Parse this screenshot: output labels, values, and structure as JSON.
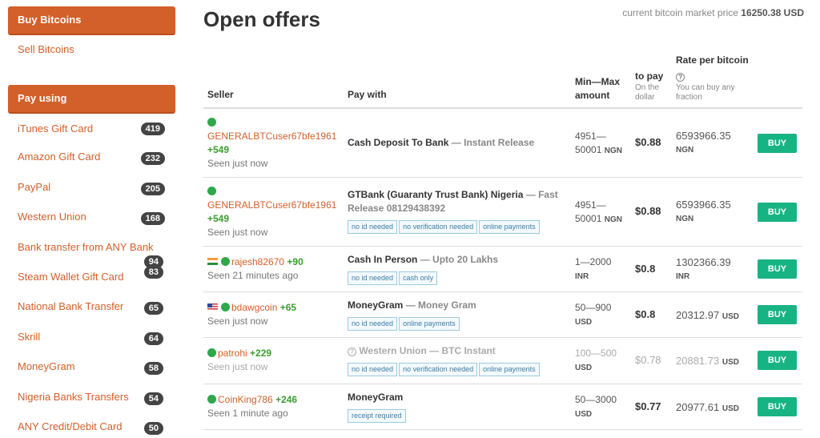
{
  "sidebar": {
    "buy_label": "Buy Bitcoins",
    "sell_label": "Sell Bitcoins",
    "pay_using_label": "Pay using",
    "items": [
      {
        "label": "iTunes Gift Card",
        "count": "419"
      },
      {
        "label": "Amazon Gift Card",
        "count": "232"
      },
      {
        "label": "PayPal",
        "count": "205"
      },
      {
        "label": "Western Union",
        "count": "168"
      },
      {
        "label": "Bank transfer from ANY Bank",
        "count": "94"
      },
      {
        "label": "Steam Wallet Gift Card",
        "count": "83"
      },
      {
        "label": "National Bank Transfer",
        "count": "65"
      },
      {
        "label": "Skrill",
        "count": "64"
      },
      {
        "label": "MoneyGram",
        "count": "58"
      },
      {
        "label": "Nigeria Banks Transfers",
        "count": "54"
      },
      {
        "label": "ANY Credit/Debit Card",
        "count": "50"
      }
    ]
  },
  "header": {
    "title": "Open offers",
    "market_prefix": "current bitcoin market price",
    "market_value": "16250.38 USD"
  },
  "columns": {
    "seller": "Seller",
    "pay_with": "Pay with",
    "min_max_1": "Min—Max",
    "min_max_2": "amount",
    "to_pay": "to pay",
    "to_pay_sub_1": "On the",
    "to_pay_sub_2": "dollar",
    "rate": "Rate per bitcoin",
    "rate_sub_1": "You can buy any",
    "rate_sub_2": "fraction"
  },
  "buy_label": "BUY",
  "offers": [
    {
      "seller": "GENERALBTCuser67bfe1961",
      "score": "+549",
      "seen": "Seen just now",
      "method": "Cash Deposit To Bank",
      "sep": " — ",
      "detail": "Instant Release",
      "tags": [],
      "amount_min": "4951—",
      "amount_max": "50001",
      "currency": "NGN",
      "to_pay": "$0.88",
      "rate": "6593966.35",
      "rate_currency": "NGN"
    },
    {
      "seller": "GENERALBTCuser67bfe1961",
      "score": "+549",
      "seen": "Seen just now",
      "method": "GTBank (Guaranty Trust Bank) Nigeria",
      "sep": " — ",
      "detail": "Fast Release 08129438392",
      "tags": [
        "no id needed",
        "no verification needed",
        "online payments"
      ],
      "amount_min": "4951—",
      "amount_max": "50001",
      "currency": "NGN",
      "to_pay": "$0.88",
      "rate": "6593966.35",
      "rate_currency": "NGN"
    },
    {
      "seller": "rajesh82670",
      "score": "+90",
      "seen": "Seen 21 minutes ago",
      "method": "Cash In Person",
      "sep": " — ",
      "detail": "Upto 20 Lakhs",
      "tags": [
        "no id needed",
        "cash only"
      ],
      "amount_min": "1—2000",
      "amount_max": "",
      "currency": "INR",
      "to_pay": "$0.8",
      "rate": "1302366.39",
      "rate_currency": "INR"
    },
    {
      "seller": "bdawgcoin",
      "score": "+65",
      "seen": "Seen just now",
      "method": "MoneyGram",
      "sep": " — ",
      "detail": "Money Gram",
      "tags": [
        "no id needed",
        "online payments"
      ],
      "amount_min": "50—900",
      "amount_max": "",
      "currency": "USD",
      "to_pay": "$0.8",
      "rate": "20312.97",
      "rate_currency": "USD"
    },
    {
      "seller": "patrohi",
      "score": "+229",
      "seen": "Seen just now",
      "method": "Western Union",
      "sep": " — ",
      "detail": "BTC Instant",
      "tags": [
        "no id needed",
        "no verification needed",
        "online payments"
      ],
      "amount_min": "100—500",
      "amount_max": "",
      "currency": "USD",
      "to_pay": "$0.78",
      "rate": "20881.73",
      "rate_currency": "USD"
    },
    {
      "seller": "CoinKing786",
      "score": "+246",
      "seen": "Seen 1 minute ago",
      "method": "MoneyGram",
      "sep": "",
      "detail": "",
      "tags": [
        "receipt required"
      ],
      "amount_min": "50—3000",
      "amount_max": "",
      "currency": "USD",
      "to_pay": "$0.77",
      "rate": "20977.61",
      "rate_currency": "USD"
    }
  ],
  "icons": {
    "online": "green-dot-icon",
    "flag_india": "india-flag-icon",
    "flag_us": "us-flag-icon",
    "help": "question-circle-icon"
  },
  "colors": {
    "accent": "#d35f2a",
    "buy": "#18b383",
    "online": "#2ea84a",
    "score": "#3a9e2f"
  }
}
